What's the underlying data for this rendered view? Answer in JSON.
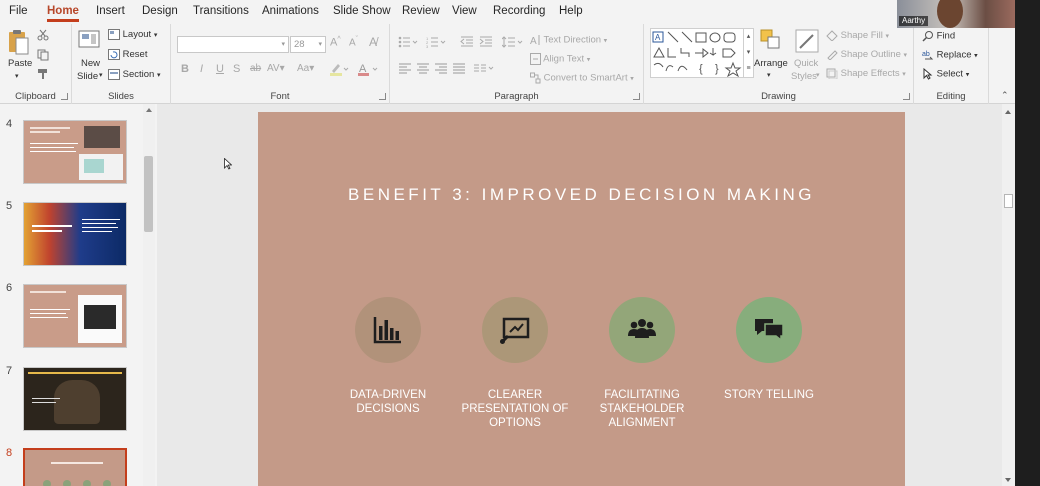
{
  "menu": {
    "items": [
      "File",
      "Home",
      "Insert",
      "Design",
      "Transitions",
      "Animations",
      "Slide Show",
      "Review",
      "View",
      "Recording",
      "Help"
    ],
    "active": "Home"
  },
  "ribbon": {
    "clipboard": {
      "label": "Clipboard",
      "paste": "Paste"
    },
    "slides": {
      "label": "Slides",
      "new_slide_1": "New",
      "new_slide_2": "Slide",
      "layout": "Layout",
      "reset": "Reset",
      "section": "Section"
    },
    "font": {
      "label": "Font",
      "size": "28"
    },
    "paragraph": {
      "label": "Paragraph",
      "text_direction": "Text Direction",
      "align_text": "Align Text",
      "convert_smartart": "Convert to SmartArt"
    },
    "drawing": {
      "label": "Drawing",
      "arrange": "Arrange",
      "quick_styles_1": "Quick",
      "quick_styles_2": "Styles",
      "shape_fill": "Shape Fill",
      "shape_outline": "Shape Outline",
      "shape_effects": "Shape Effects"
    },
    "editing": {
      "label": "Editing",
      "find": "Find",
      "replace": "Replace",
      "select": "Select"
    }
  },
  "webcam": {
    "name": "Aarthy"
  },
  "thumbnails": {
    "items": [
      {
        "number": "4"
      },
      {
        "number": "5"
      },
      {
        "number": "6"
      },
      {
        "number": "7"
      },
      {
        "number": "8"
      }
    ],
    "active": "8"
  },
  "slide": {
    "title": "BENEFIT 3: IMPROVED DECISION MAKING",
    "background": "#c49a88",
    "benefits": [
      {
        "icon": "bar-chart-icon",
        "label_1": "DATA-DRIVEN",
        "label_2": "DECISIONS",
        "label_3": "",
        "color": "#b1927a"
      },
      {
        "icon": "presentation-icon",
        "label_1": "CLEARER",
        "label_2": "PRESENTATION OF",
        "label_3": "OPTIONS",
        "color": "#ac9778"
      },
      {
        "icon": "people-group-icon",
        "label_1": "FACILITATING",
        "label_2": "STAKEHOLDER",
        "label_3": "ALIGNMENT",
        "color": "#93a679"
      },
      {
        "icon": "chat-bubbles-icon",
        "label_1": "STORY TELLING",
        "label_2": "",
        "label_3": "",
        "color": "#87ad7c"
      }
    ]
  }
}
